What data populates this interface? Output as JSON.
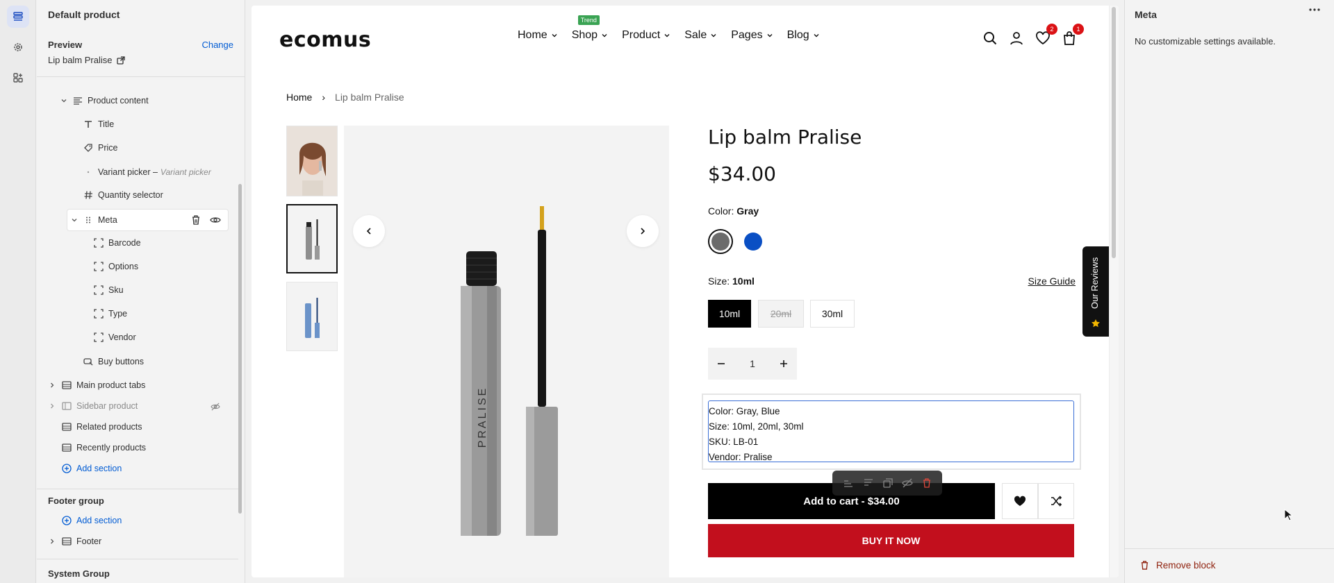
{
  "sidebar": {
    "title": "Default product",
    "preview_label": "Preview",
    "change_label": "Change",
    "preview_name": "Lip balm Pralise",
    "tree": {
      "product_content": "Product content",
      "title": "Title",
      "price": "Price",
      "variant_picker": "Variant picker –",
      "variant_picker_type": "Variant picker",
      "quantity_selector": "Quantity selector",
      "meta": "Meta",
      "barcode": "Barcode",
      "options": "Options",
      "sku": "Sku",
      "type": "Type",
      "vendor": "Vendor",
      "buy_buttons": "Buy buttons",
      "main_product_tabs": "Main product tabs",
      "sidebar_product": "Sidebar product",
      "related_products": "Related products",
      "recently_products": "Recently products",
      "add_section": "Add section"
    },
    "footer_group": {
      "title": "Footer group",
      "add_section": "Add section",
      "footer": "Footer"
    },
    "system_group": "System Group"
  },
  "store": {
    "logo": "ecomus",
    "nav": [
      "Home",
      "Shop",
      "Product",
      "Sale",
      "Pages",
      "Blog"
    ],
    "trend_badge": "Trend",
    "wishlist_count": "2",
    "cart_count": "1",
    "breadcrumb": {
      "home": "Home",
      "separator": "›",
      "current": "Lip balm Pralise"
    },
    "product": {
      "title": "Lip balm Pralise",
      "price": "$34.00",
      "color_label": "Color:",
      "color_value": "Gray",
      "colors": [
        "#6b6b6b",
        "#0a4fc4"
      ],
      "size_label": "Size:",
      "size_value": "10ml",
      "size_guide": "Size Guide",
      "sizes": [
        "10ml",
        "20ml",
        "30ml"
      ],
      "quantity": "1",
      "image_brand_text": "PRALISE",
      "meta_lines": [
        "Color: Gray, Blue",
        "Size: 10ml, 20ml, 30ml",
        "SKU: LB-01",
        "Vendor: Pralise"
      ],
      "add_to_cart": "Add to cart - $34.00",
      "buy_now": "BUY IT NOW"
    },
    "reviews_tab": "Our Reviews",
    "colors": {
      "buy_now": "#c20f1d",
      "badge": "#db1215",
      "selection": "#3b6fd6",
      "trend": "#3aa353"
    }
  },
  "right_panel": {
    "title": "Meta",
    "message": "No customizable settings available.",
    "remove_block": "Remove block"
  }
}
